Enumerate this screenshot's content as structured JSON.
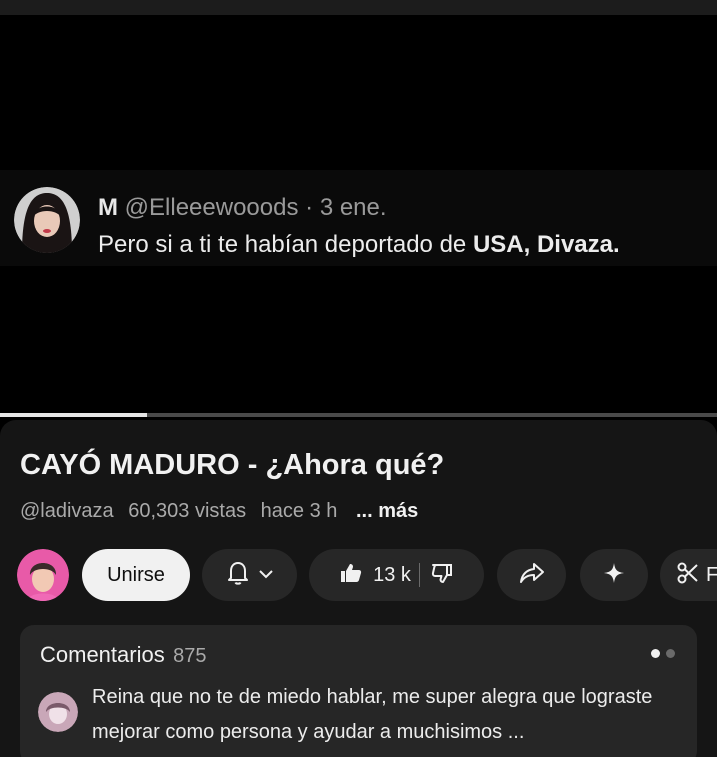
{
  "tweet": {
    "display_name": "M",
    "handle": "@Elleeewooods",
    "date": "· 3 ene.",
    "text_before": "Pero si a ti te habían deportado de ",
    "text_bold": "USA, Divaza."
  },
  "player": {
    "progress": 0.205
  },
  "video": {
    "title": "CAYÓ MADURO -  ¿Ahora qué?",
    "channel": "@ladivaza",
    "views": "60,303 vistas",
    "age": "hace 3 h",
    "more": "... más"
  },
  "actions": {
    "join_label": "Unirse",
    "like_count": "13 k",
    "clip_partial": "F"
  },
  "comments": {
    "label": "Comentarios",
    "count": "875",
    "page_indicator": {
      "total": 2,
      "active": 0
    },
    "top_comment": "Reina que no te de miedo hablar, me super alegra que lograste mejorar como persona y ayudar a muchisimos ..."
  },
  "icons": [
    "bell-icon",
    "chevron-down-icon",
    "thumbs-up-icon",
    "thumbs-down-icon",
    "share-icon",
    "sparkle-icon",
    "scissors-icon"
  ],
  "colors": {
    "background": "#000000",
    "panel": "#151515",
    "pill": "#272727",
    "comment_card": "#262626",
    "join_button": "#f1f1f1",
    "secondary_text": "#aaaaaa"
  }
}
